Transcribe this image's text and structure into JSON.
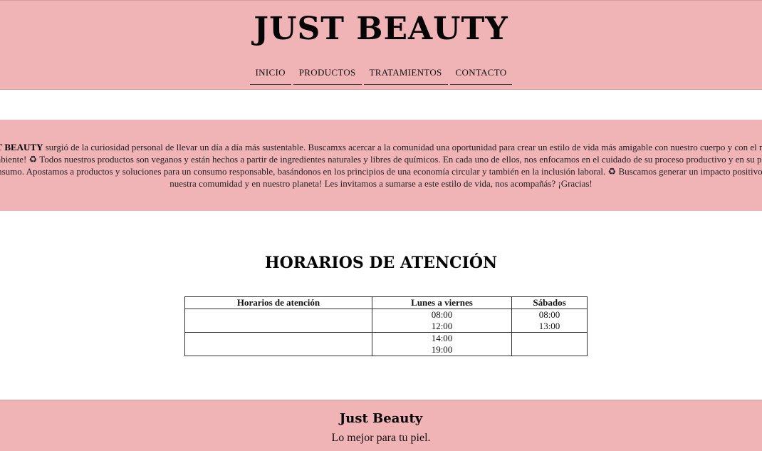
{
  "header": {
    "brand": "JUST BEAUTY",
    "nav": [
      "INICIO",
      "PRODUCTOS",
      "TRATAMIENTOS",
      "CONTACTO"
    ]
  },
  "about": {
    "brand_bold": "JUST BEAUTY",
    "text": " surgió de la curiosidad personal de llevar un día a día más sustentable. Buscamxs acercar a la comunidad una oportunidad para crear un estilo de vida más amigable con nuestro cuerpo y con el medio ambiente! ♻ Todos nuestros productos son veganos y están hechos a partir de ingredientes naturales y libres de químicos. En cada uno de ellos, nos enfocamos en el cuidado de su proceso productivo y en su post consumo. Apostamos a productos y soluciones para un consumo responsable, basándonos en los principios de una economía circular y también en la inclusión laboral. ♻ Buscamos generar un impacto positivo en nuestra comumidad y en nuestro planeta! Les invitamos a sumarse a este estilo de vida, nos acompañás? ¡Gracias!"
  },
  "hours": {
    "title": "HORARIOS DE ATENCIÓN",
    "headers": [
      "Horarios de atención",
      "Lunes a viernes",
      "Sábados"
    ],
    "rows": [
      [
        "",
        "08:00\n12:00",
        "08:00\n13:00"
      ],
      [
        "",
        "14:00\n19:00",
        ""
      ]
    ]
  },
  "footer": {
    "title": "Just Beauty",
    "subtitle": "Lo mejor para tu piel."
  }
}
